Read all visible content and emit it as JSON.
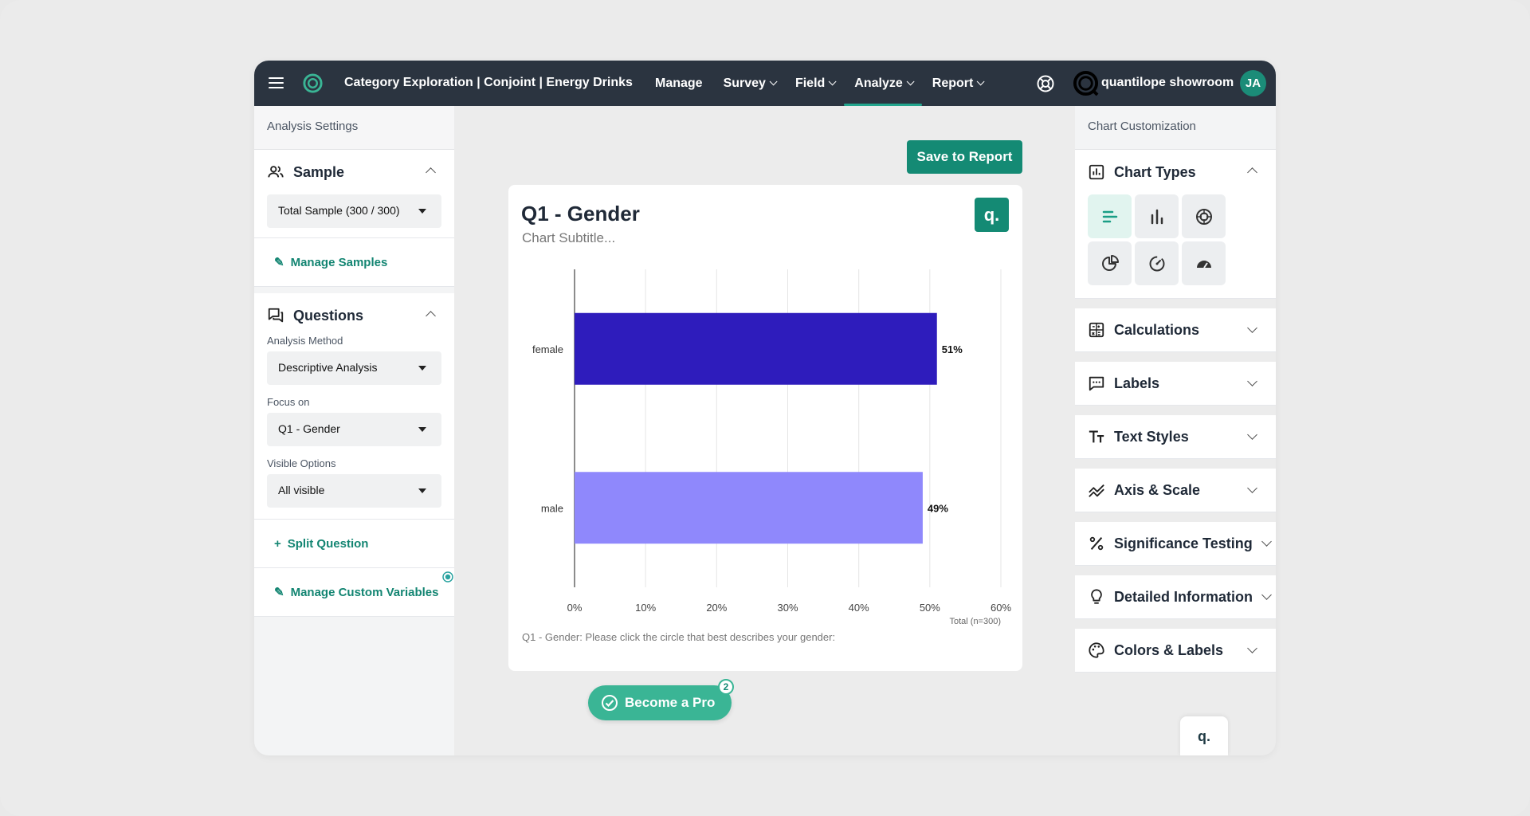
{
  "topbar": {
    "project_title": "Category Exploration | Conjoint | Energy Drinks",
    "nav": [
      {
        "label": "Manage",
        "dropdown": false,
        "active": false
      },
      {
        "label": "Survey",
        "dropdown": true,
        "active": false
      },
      {
        "label": "Field",
        "dropdown": true,
        "active": false
      },
      {
        "label": "Analyze",
        "dropdown": true,
        "active": true
      },
      {
        "label": "Report",
        "dropdown": true,
        "active": false
      }
    ],
    "org_name": "quantilope showroom",
    "avatar_initials": "JA"
  },
  "left": {
    "header": "Analysis Settings",
    "sample": {
      "title": "Sample",
      "selected": "Total Sample (300 / 300)",
      "manage_link": "Manage Samples"
    },
    "questions": {
      "title": "Questions",
      "analysis_method_label": "Analysis Method",
      "analysis_method": "Descriptive Analysis",
      "focus_label": "Focus on",
      "focus": "Q1 - Gender",
      "visible_label": "Visible Options",
      "visible": "All visible",
      "split_link": "Split Question",
      "custom_link": "Manage Custom Variables"
    }
  },
  "center": {
    "save_button": "Save to Report",
    "chart_title": "Q1 - Gender",
    "chart_subtitle": "Chart Subtitle...",
    "badge": "q.",
    "caption": "Q1 - Gender: Please click the circle that best describes your gender:",
    "total_label": "Total (n=300)",
    "pro_button": "Become a Pro",
    "pro_count": "2"
  },
  "chart_data": {
    "type": "bar",
    "orientation": "horizontal",
    "categories": [
      "female",
      "male"
    ],
    "values": [
      51,
      49
    ],
    "value_labels": [
      "51%",
      "49%"
    ],
    "colors": [
      "#2e1cbc",
      "#8f88fc"
    ],
    "xlim": [
      0,
      60
    ],
    "x_ticks": [
      "0%",
      "10%",
      "20%",
      "30%",
      "40%",
      "50%",
      "60%"
    ],
    "grid": true
  },
  "right": {
    "header": "Chart Customization",
    "chart_types_title": "Chart Types",
    "chart_types": [
      {
        "icon": "horizontal-bar-chart-icon",
        "active": true
      },
      {
        "icon": "vertical-bar-chart-icon",
        "active": false
      },
      {
        "icon": "radar-chart-icon",
        "active": false
      },
      {
        "icon": "pie-chart-icon",
        "active": false
      },
      {
        "icon": "speedometer-icon",
        "active": false
      },
      {
        "icon": "gauge-icon",
        "active": false
      }
    ],
    "sections": [
      {
        "label": "Calculations",
        "icon": "calculator-icon"
      },
      {
        "label": "Labels",
        "icon": "comment-icon"
      },
      {
        "label": "Text Styles",
        "icon": "text-size-icon"
      },
      {
        "label": "Axis & Scale",
        "icon": "axis-icon"
      },
      {
        "label": "Significance Testing",
        "icon": "percent-icon"
      },
      {
        "label": "Detailed Information",
        "icon": "lightbulb-icon"
      },
      {
        "label": "Colors & Labels",
        "icon": "palette-icon"
      }
    ],
    "chat_badge": "q."
  },
  "colors": {
    "brand": "#148a74",
    "topbar": "#2b3440",
    "bar_primary": "#2e1cbc",
    "bar_secondary": "#8f88fc"
  }
}
